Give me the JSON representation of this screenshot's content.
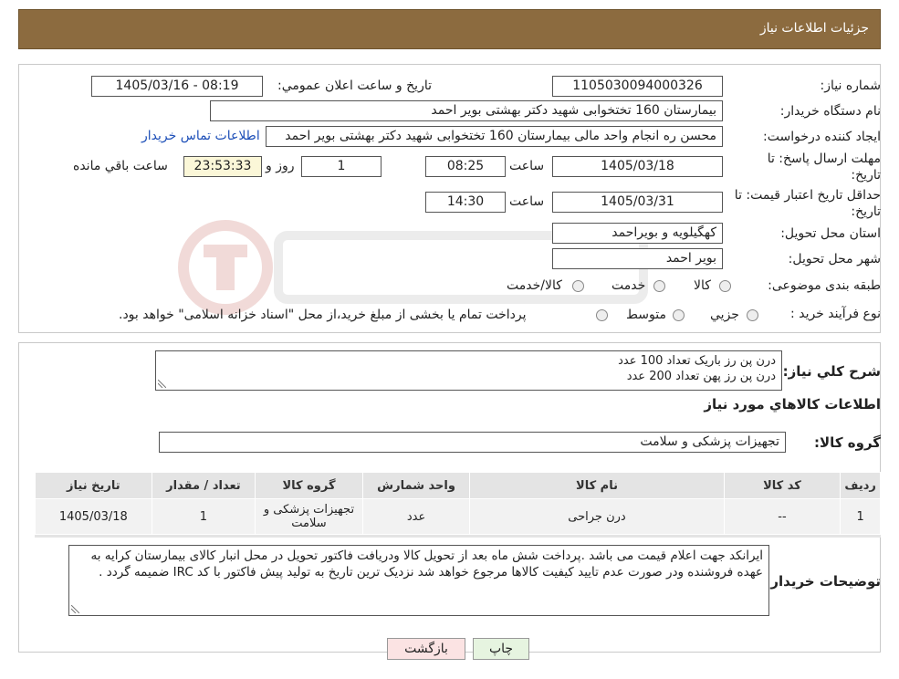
{
  "header": {
    "title": "جزئیات اطلاعات نیاز"
  },
  "form": {
    "need_number_label": "شماره نیاز:",
    "need_number": "1105030094000326",
    "announce_label": "تاریخ و ساعت اعلان عمومي:",
    "announce_value": "1405/03/16 - 08:19",
    "buyer_org_label": "نام دستگاه خريدار:",
    "buyer_org": "بیمارستان 160 تختخوابی شهید دکتر بهشتی بویر احمد",
    "creator_label": "ايجاد کننده درخواست:",
    "creator": "محسن ره انجام واحد مالی بیمارستان 160 تختخوابی شهید دکتر بهشتی بویر احمد",
    "contact_link": "اطلاعات تماس خريدار",
    "deadline_label_1": "مهلت ارسال پاسخ: تا",
    "deadline_label_2": "تاريخ:",
    "deadline_date": "1405/03/18",
    "time_label": "ساعت",
    "deadline_time": "08:25",
    "days_value": "1",
    "days_label": "روز و",
    "remaining_value": "23:53:33",
    "remaining_label": "ساعت باقي مانده",
    "validity_label_1": "حداقل تاريخ اعتبار قيمت: تا",
    "validity_label_2": "تاريخ:",
    "validity_date": "1405/03/31",
    "validity_time": "14:30",
    "province_label": "استان محل تحويل:",
    "province": "کهگیلویه و بویراحمد",
    "city_label": "شهر محل تحويل:",
    "city": "بویر احمد",
    "category_label": "طبقه بندی موضوعی:",
    "category_options": [
      "کالا",
      "خدمت",
      "کالا/خدمت"
    ],
    "purchase_label": "نوع فرآيند خريد :",
    "purchase_options": [
      "جزيي",
      "متوسط"
    ],
    "purchase_note": "پرداخت تمام يا بخشی از مبلغ خريد،از محل \"اسناد خزانه اسلامی\" خواهد بود."
  },
  "summary": {
    "label": "شرح کلي نياز:",
    "lines": [
      "درن پن رز باریک تعداد 100 عدد",
      "درن پن رز پهن تعداد 200 عدد"
    ],
    "goods_info_title": "اطلاعات کالاهاي مورد نياز",
    "group_label": "گروه کالا:",
    "group_value": "تجهیزات پزشکی و سلامت"
  },
  "table": {
    "headers": [
      "رديف",
      "کد کالا",
      "نام کالا",
      "واحد شمارش",
      "گروه کالا",
      "تعداد / مقدار",
      "تاريخ نياز"
    ],
    "rows": [
      [
        "1",
        "--",
        "درن جراحی",
        "عدد",
        "تجهیزات پزشکی و سلامت",
        "1",
        "1405/03/18"
      ]
    ]
  },
  "buyer_notes": {
    "label": "توضيحات خريدار:",
    "text": "ایرانکد جهت اعلام قیمت می باشد .پرداخت شش ماه بعد از تحویل کالا ودریافت فاکتور تحویل در محل انبار کالای بیمارستان کرایه به عهده فروشنده ودر صورت عدم تایید کیفیت کالاها مرجوع خواهد شد نزدیک ترین تاریخ به تولید پیش فاکتور با کد IRC ضمیمه گردد ."
  },
  "buttons": {
    "print": "چاپ",
    "back": "بازگشت"
  },
  "colors": {
    "header_bg": "#8c6b3f",
    "link": "#1d4fb8",
    "back_bg": "#fbe3e3",
    "print_bg": "#e6f4e0"
  }
}
